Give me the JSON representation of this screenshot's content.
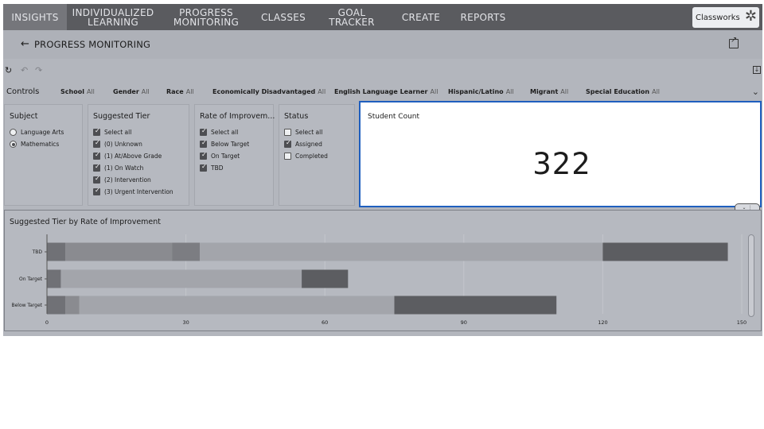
{
  "nav": {
    "items": [
      {
        "label": "INSIGHTS",
        "active": true
      },
      {
        "label": "INDIVIDUALIZED LEARNING",
        "active": false
      },
      {
        "label": "PROGRESS MONITORING",
        "active": false
      },
      {
        "label": "CLASSES",
        "active": false
      },
      {
        "label": "GOAL TRACKER",
        "active": false
      },
      {
        "label": "CREATE",
        "active": false
      },
      {
        "label": "REPORTS",
        "active": false
      }
    ],
    "brand": "Classworks"
  },
  "header": {
    "title": "PROGRESS MONITORING"
  },
  "controls": {
    "label": "Controls",
    "items": [
      {
        "name": "School",
        "value": "All"
      },
      {
        "name": "Gender",
        "value": "All"
      },
      {
        "name": "Race",
        "value": "All"
      },
      {
        "name": "Economically Disadvantaged",
        "value": "All"
      },
      {
        "name": "English Language Learner",
        "value": "All"
      },
      {
        "name": "Hispanic/Latino",
        "value": "All"
      },
      {
        "name": "Migrant",
        "value": "All"
      },
      {
        "name": "Special Education",
        "value": "All"
      }
    ]
  },
  "filters": {
    "subject": {
      "title": "Subject",
      "options": [
        {
          "label": "Language Arts",
          "selected": false
        },
        {
          "label": "Mathematics",
          "selected": true
        }
      ]
    },
    "tier": {
      "title": "Suggested Tier",
      "options": [
        {
          "label": "Select all",
          "checked": true
        },
        {
          "label": "(0) Unknown",
          "checked": true
        },
        {
          "label": "(1) At/Above Grade",
          "checked": true
        },
        {
          "label": "(1) On Watch",
          "checked": true
        },
        {
          "label": "(2) Intervention",
          "checked": true
        },
        {
          "label": "(3) Urgent Intervention",
          "checked": true
        }
      ]
    },
    "roi": {
      "title": "Rate of Improvem...",
      "options": [
        {
          "label": "Select all",
          "checked": true
        },
        {
          "label": "Below Target",
          "checked": true
        },
        {
          "label": "On Target",
          "checked": true
        },
        {
          "label": "TBD",
          "checked": true
        }
      ]
    },
    "status": {
      "title": "Status",
      "options": [
        {
          "label": "Select all",
          "checked": false
        },
        {
          "label": "Assigned",
          "checked": true
        },
        {
          "label": "Completed",
          "checked": false
        }
      ]
    }
  },
  "kpi": {
    "title": "Student Count",
    "value": "322"
  },
  "chart_data": {
    "type": "bar",
    "orientation": "horizontal",
    "stacked": true,
    "title": "Suggested Tier by Rate of Improvement",
    "categories": [
      "TBD",
      "On Target",
      "Below Target"
    ],
    "x_ticks": [
      0,
      30,
      60,
      90,
      120,
      150
    ],
    "xlim": [
      0,
      150
    ],
    "grid": true,
    "series": [
      {
        "values": [
          4,
          3,
          4
        ],
        "color": "#707176"
      },
      {
        "values": [
          23,
          0,
          3
        ],
        "color": "#8a8b90"
      },
      {
        "values": [
          6,
          0,
          0
        ],
        "color": "#7c7d82"
      },
      {
        "values": [
          87,
          52,
          68
        ],
        "color": "#a3a5ab"
      },
      {
        "values": [
          27,
          10,
          35
        ],
        "color": "#5c5d61"
      }
    ]
  }
}
